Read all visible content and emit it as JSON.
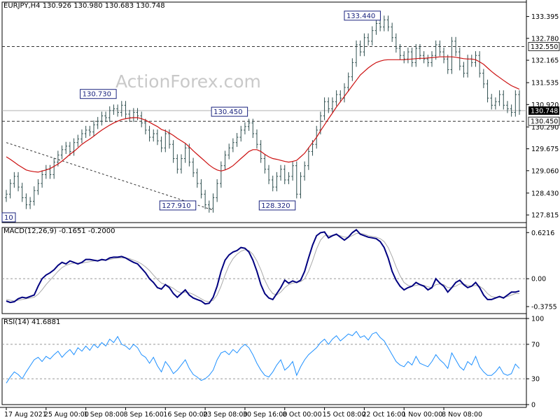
{
  "chart_data": {
    "type": "line",
    "panels": {
      "price": {
        "title": "EURJPY,H4  130.926 130.980 130.683 130.748",
        "ylim": [
          127.6,
          133.8
        ],
        "yticks": [
          "133.395",
          "132.780",
          "132.165",
          "131.535",
          "130.920",
          "130.290",
          "129.675",
          "129.060",
          "128.430",
          "127.815"
        ],
        "yvals": [
          133.395,
          132.78,
          132.165,
          131.535,
          130.92,
          130.29,
          129.675,
          129.06,
          128.43,
          127.815
        ],
        "levels": [
          {
            "label": "132.550",
            "value": 132.55,
            "style": "dashed-dark"
          },
          {
            "label": "130.748",
            "value": 130.748,
            "style": "solid-grey",
            "current": true
          },
          {
            "label": "130.450",
            "value": 130.45,
            "style": "dashed-dark"
          }
        ],
        "annotations": [
          {
            "label": "130.730",
            "x": 28
          },
          {
            "label": "127.910",
            "x": 48
          },
          {
            "label": "130.450",
            "x": 61
          },
          {
            "label": "128.320",
            "x": 73
          },
          {
            "label": "133.440",
            "x": 93
          },
          {
            "label": "10",
            "x": 0
          }
        ],
        "trendline": [
          {
            "x": 0,
            "y": 129.85
          },
          {
            "x": 52,
            "y": 127.95
          }
        ],
        "close": [
          128.4,
          128.7,
          128.9,
          128.6,
          128.3,
          128.1,
          128.2,
          128.5,
          128.7,
          128.95,
          129.1,
          128.95,
          129.3,
          129.5,
          129.65,
          129.75,
          129.6,
          129.85,
          129.95,
          130.1,
          130.2,
          130.15,
          130.35,
          130.45,
          130.6,
          130.55,
          130.75,
          130.8,
          130.7,
          130.9,
          130.65,
          130.55,
          130.7,
          130.6,
          130.4,
          130.2,
          130.0,
          130.1,
          129.9,
          129.7,
          130.1,
          129.8,
          129.4,
          129.1,
          129.4,
          129.7,
          129.3,
          129.0,
          128.7,
          128.4,
          128.1,
          128.0,
          128.3,
          128.7,
          129.2,
          129.5,
          129.7,
          129.85,
          130.0,
          130.2,
          130.3,
          130.4,
          130.1,
          129.8,
          129.4,
          129.1,
          128.8,
          128.6,
          128.9,
          129.1,
          128.8,
          128.9,
          129.2,
          128.4,
          128.9,
          129.2,
          129.6,
          129.8,
          130.2,
          130.6,
          131.0,
          130.8,
          131.0,
          131.2,
          131.1,
          131.4,
          131.7,
          132.1,
          132.6,
          132.4,
          132.8,
          132.7,
          133.0,
          133.2,
          133.1,
          133.3,
          133.1,
          132.8,
          132.5,
          132.3,
          132.2,
          132.4,
          132.1,
          132.5,
          132.3,
          132.2,
          132.1,
          132.3,
          132.6,
          132.4,
          132.2,
          131.9,
          132.7,
          132.4,
          132.0,
          131.8,
          132.2,
          132.1,
          132.3,
          131.8,
          131.5,
          131.1,
          130.9,
          131.0,
          131.2,
          130.9,
          130.8,
          130.7,
          131.2,
          130.75
        ],
        "ma": [
          129.45,
          129.38,
          129.3,
          129.22,
          129.15,
          129.08,
          129.05,
          129.03,
          129.02,
          129.05,
          129.08,
          129.12,
          129.18,
          129.25,
          129.33,
          129.42,
          129.52,
          129.6,
          129.7,
          129.8,
          129.88,
          129.95,
          130.03,
          130.12,
          130.2,
          130.27,
          130.34,
          130.4,
          130.45,
          130.5,
          130.52,
          130.54,
          130.55,
          130.55,
          130.52,
          130.48,
          130.42,
          130.36,
          130.3,
          130.22,
          130.18,
          130.12,
          130.05,
          129.97,
          129.9,
          129.83,
          129.73,
          129.62,
          129.52,
          129.42,
          129.32,
          129.22,
          129.14,
          129.08,
          129.05,
          129.08,
          129.13,
          129.2,
          129.3,
          129.4,
          129.5,
          129.6,
          129.65,
          129.65,
          129.6,
          129.52,
          129.45,
          129.4,
          129.38,
          129.35,
          129.32,
          129.3,
          129.32,
          129.35,
          129.45,
          129.55,
          129.7,
          129.85,
          130.0,
          130.18,
          130.35,
          130.52,
          130.68,
          130.85,
          131.0,
          131.15,
          131.3,
          131.45,
          131.6,
          131.75,
          131.85,
          131.95,
          132.03,
          132.1,
          132.14,
          132.17,
          132.18,
          132.18,
          132.18,
          132.18,
          132.18,
          132.19,
          132.2,
          132.21,
          132.22,
          132.22,
          132.23,
          132.24,
          132.25,
          132.26,
          132.26,
          132.26,
          132.26,
          132.25,
          132.23,
          132.21,
          132.2,
          132.2,
          132.18,
          132.12,
          132.05,
          131.95,
          131.85,
          131.76,
          131.68,
          131.6,
          131.52,
          131.45,
          131.4,
          131.35
        ]
      },
      "macd": {
        "title": "MACD(12,26,9) -0.1651 -0.2000",
        "ylim": [
          -0.47,
          0.69
        ],
        "yticks": [
          "0.6216",
          "0.00",
          "-0.3755"
        ],
        "yvals": [
          0.6216,
          0.0,
          -0.3755
        ],
        "macd": [
          -0.3,
          -0.32,
          -0.31,
          -0.27,
          -0.25,
          -0.26,
          -0.24,
          -0.22,
          -0.1,
          0.0,
          0.05,
          0.08,
          0.12,
          0.18,
          0.22,
          0.2,
          0.24,
          0.22,
          0.2,
          0.22,
          0.26,
          0.26,
          0.25,
          0.24,
          0.26,
          0.25,
          0.28,
          0.29,
          0.29,
          0.3,
          0.28,
          0.25,
          0.22,
          0.2,
          0.14,
          0.08,
          0.0,
          -0.05,
          -0.12,
          -0.14,
          -0.08,
          -0.12,
          -0.2,
          -0.25,
          -0.2,
          -0.15,
          -0.22,
          -0.26,
          -0.28,
          -0.3,
          -0.34,
          -0.33,
          -0.25,
          -0.1,
          0.1,
          0.25,
          0.32,
          0.36,
          0.38,
          0.42,
          0.41,
          0.36,
          0.25,
          0.1,
          -0.08,
          -0.2,
          -0.26,
          -0.28,
          -0.2,
          -0.12,
          -0.02,
          -0.06,
          -0.03,
          -0.05,
          -0.02,
          0.1,
          0.28,
          0.45,
          0.58,
          0.62,
          0.63,
          0.55,
          0.58,
          0.6,
          0.56,
          0.52,
          0.56,
          0.62,
          0.66,
          0.6,
          0.58,
          0.56,
          0.55,
          0.54,
          0.5,
          0.42,
          0.28,
          0.1,
          -0.02,
          -0.1,
          -0.15,
          -0.12,
          -0.1,
          -0.05,
          -0.08,
          -0.1,
          -0.15,
          -0.12,
          0.0,
          -0.06,
          -0.1,
          -0.18,
          -0.12,
          -0.05,
          -0.02,
          -0.08,
          -0.12,
          -0.1,
          -0.05,
          -0.12,
          -0.22,
          -0.28,
          -0.28,
          -0.26,
          -0.24,
          -0.26,
          -0.22,
          -0.18,
          -0.18,
          -0.165
        ],
        "signal": [
          -0.28,
          -0.29,
          -0.3,
          -0.29,
          -0.28,
          -0.27,
          -0.26,
          -0.25,
          -0.21,
          -0.15,
          -0.08,
          -0.02,
          0.04,
          0.1,
          0.15,
          0.18,
          0.2,
          0.21,
          0.21,
          0.21,
          0.22,
          0.23,
          0.24,
          0.24,
          0.25,
          0.25,
          0.26,
          0.27,
          0.28,
          0.28,
          0.28,
          0.27,
          0.25,
          0.23,
          0.2,
          0.16,
          0.11,
          0.05,
          -0.01,
          -0.06,
          -0.08,
          -0.1,
          -0.13,
          -0.17,
          -0.19,
          -0.18,
          -0.19,
          -0.21,
          -0.24,
          -0.27,
          -0.3,
          -0.31,
          -0.29,
          -0.22,
          -0.1,
          0.05,
          0.18,
          0.27,
          0.33,
          0.37,
          0.39,
          0.38,
          0.33,
          0.24,
          0.12,
          -0.02,
          -0.13,
          -0.2,
          -0.22,
          -0.18,
          -0.12,
          -0.08,
          -0.06,
          -0.05,
          -0.04,
          0.0,
          0.1,
          0.24,
          0.4,
          0.52,
          0.58,
          0.58,
          0.58,
          0.59,
          0.58,
          0.56,
          0.56,
          0.58,
          0.61,
          0.61,
          0.6,
          0.58,
          0.57,
          0.56,
          0.54,
          0.5,
          0.42,
          0.3,
          0.16,
          0.04,
          -0.05,
          -0.09,
          -0.1,
          -0.09,
          -0.08,
          -0.09,
          -0.11,
          -0.12,
          -0.08,
          -0.07,
          -0.08,
          -0.12,
          -0.12,
          -0.1,
          -0.07,
          -0.07,
          -0.09,
          -0.1,
          -0.09,
          -0.1,
          -0.14,
          -0.2,
          -0.24,
          -0.25,
          -0.25,
          -0.25,
          -0.24,
          -0.22,
          -0.2,
          -0.2
        ]
      },
      "rsi": {
        "title": "RSI(14) 41.6881",
        "ylim": [
          0,
          100
        ],
        "yticks": [
          "100",
          "70",
          "30",
          "0"
        ],
        "yvals": [
          100,
          70,
          30,
          0
        ],
        "levels": [
          70,
          30
        ],
        "values": [
          25,
          32,
          38,
          35,
          30,
          38,
          45,
          52,
          55,
          50,
          56,
          53,
          58,
          62,
          55,
          60,
          64,
          58,
          66,
          62,
          68,
          63,
          70,
          66,
          72,
          68,
          76,
          72,
          79,
          70,
          68,
          64,
          70,
          66,
          58,
          55,
          48,
          55,
          45,
          38,
          50,
          44,
          36,
          40,
          46,
          52,
          42,
          35,
          32,
          28,
          30,
          34,
          40,
          52,
          60,
          62,
          58,
          64,
          60,
          66,
          70,
          66,
          58,
          48,
          40,
          34,
          32,
          38,
          46,
          52,
          40,
          44,
          50,
          34,
          44,
          52,
          58,
          62,
          66,
          72,
          76,
          70,
          76,
          80,
          74,
          78,
          82,
          80,
          85,
          78,
          80,
          75,
          82,
          84,
          78,
          74,
          66,
          58,
          50,
          46,
          44,
          50,
          46,
          56,
          48,
          46,
          44,
          50,
          58,
          52,
          48,
          42,
          60,
          52,
          44,
          40,
          50,
          46,
          56,
          44,
          38,
          34,
          34,
          38,
          44,
          36,
          34,
          36,
          47,
          42
        ]
      }
    },
    "x_labels": [
      {
        "label": "17 Aug 2021",
        "x": 0
      },
      {
        "label": "25 Aug 00:00",
        "x": 10
      },
      {
        "label": "1 Sep 08:00",
        "x": 20
      },
      {
        "label": "8 Sep 16:00",
        "x": 30
      },
      {
        "label": "16 Sep 00:00",
        "x": 40
      },
      {
        "label": "23 Sep 08:00",
        "x": 50
      },
      {
        "label": "30 Sep 16:00",
        "x": 60
      },
      {
        "label": "8 Oct 00:00",
        "x": 70
      },
      {
        "label": "15 Oct 08:00",
        "x": 80
      },
      {
        "label": "22 Oct 16:00",
        "x": 90
      },
      {
        "label": "1 Nov 00:00",
        "x": 100
      },
      {
        "label": "8 Nov 08:00",
        "x": 110
      }
    ],
    "watermark": "ActionForex.com",
    "colors": {
      "candle": "#2f4f4f",
      "ma": "#cc1111",
      "macd": "#000080",
      "signal": "#a9a9a9",
      "rsi": "#1e90ff",
      "label_box": "#1a237e",
      "label_bg": "#ffffff",
      "current_tag": "#000000",
      "grid_dash": "#333333",
      "level_dash": "#999999"
    }
  }
}
